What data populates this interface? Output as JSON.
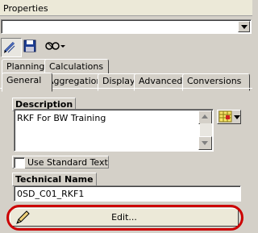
{
  "panel": {
    "title": "Properties"
  },
  "top_combo": {
    "value": ""
  },
  "toolbar": {
    "edit_icon": "pencil-edit-icon",
    "save_icon": "floppy-disk-icon",
    "tools_icon": "glasses-tools-icon"
  },
  "tabs_row1": [
    {
      "label": "Planning"
    },
    {
      "label": "Calculations"
    }
  ],
  "tabs_row2": [
    {
      "label": "General",
      "active": true
    },
    {
      "label": "Aggregation"
    },
    {
      "label": "Display"
    },
    {
      "label": "Advanced"
    },
    {
      "label": "Conversions"
    }
  ],
  "general": {
    "description_label": "Description",
    "description_value": "RKF For BW Training",
    "use_standard_text_label": "Use Standard Text",
    "use_standard_text_checked": false,
    "technical_name_label": "Technical Name",
    "technical_name_value": "0SD_C01_RKF1",
    "edit_button_label": "Edit..."
  },
  "colors": {
    "highlight_ring": "#cc0000",
    "panel_bg": "#d4d0c8"
  }
}
